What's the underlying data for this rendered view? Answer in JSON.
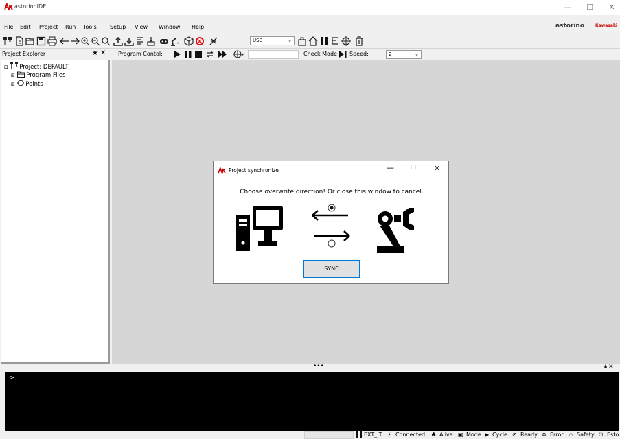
{
  "app": {
    "title": "astorinoIDE",
    "brand": "astorino",
    "brand_partner": "Kawasaki"
  },
  "window": {
    "minimize": "—",
    "maximize": "☐",
    "close": "✕"
  },
  "menu": [
    "File",
    "Edit",
    "Project",
    "Run",
    "Tools",
    "Setup",
    "View",
    "Window",
    "Help"
  ],
  "toolbar": {
    "connection_value": "USB"
  },
  "explorer": {
    "title": "Project Explorer",
    "pin": "★",
    "close": "✕",
    "tree": {
      "project": "Project: DEFAULT",
      "program_files": "Program Files",
      "points": "Points"
    }
  },
  "program_control": {
    "label": "Program Contol:",
    "check_mode_label": "Check Mode:",
    "speed_label": "Speed:",
    "speed_value": "2"
  },
  "dialog": {
    "title": "Project synchronize",
    "message": "Choose overwrite direction! Or close this window to cancel.",
    "sync_button": "SYNC",
    "direction_selected": "robot-to-pc"
  },
  "output": {
    "dots": "•••",
    "pin": "★✕",
    "prompt": ">"
  },
  "status": {
    "ext_it": "EXT_IT",
    "connected": "Connected",
    "alive": "Alive",
    "mode": "Mode",
    "cycle": "Cycle",
    "ready": "Ready",
    "error": "Error",
    "safety": "Safety",
    "estop": "Esto"
  },
  "colors": {
    "accent": "#0078d7",
    "logo": "#cc0000",
    "workspace": "#d6d6d6",
    "console": "#000000"
  }
}
